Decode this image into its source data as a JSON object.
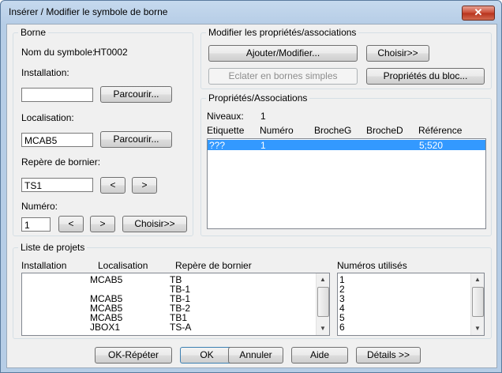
{
  "window": {
    "title": "Insérer / Modifier le symbole de borne",
    "close_label": "✕"
  },
  "borne": {
    "group_label": "Borne",
    "symbol_name_label": "Nom du symbole:",
    "symbol_name_value": "HT0002",
    "installation_label": "Installation:",
    "installation_value": "",
    "localisation_label": "Localisation:",
    "localisation_value": "MCAB5",
    "repere_label": "Repère de bornier:",
    "repere_value": "TS1",
    "numero_label": "Numéro:",
    "numero_value": "1",
    "browse_label": "Parcourir...",
    "prev_label": "<",
    "next_label": ">",
    "choose_label": "Choisir>>"
  },
  "modify": {
    "group_label": "Modifier les propriétés/associations",
    "add_modify_label": "Ajouter/Modifier...",
    "choose_label": "Choisir>>",
    "explode_label": "Eclater en bornes simples",
    "block_props_label": "Propriétés du bloc..."
  },
  "props": {
    "group_label": "Propriétés/Associations",
    "levels_label": "Niveaux:",
    "levels_value": "1",
    "columns": [
      "Etiquette",
      "Numéro",
      "BrocheG",
      "BrocheD",
      "Référence"
    ],
    "rows": [
      [
        "???",
        "1",
        "",
        "",
        "5;520"
      ]
    ]
  },
  "projects": {
    "group_label": "Liste de projets",
    "columns": [
      "Installation",
      "Localisation",
      "Repère de bornier"
    ],
    "rows": [
      [
        "",
        "MCAB5",
        "TB"
      ],
      [
        "",
        "",
        "TB-1"
      ],
      [
        "",
        "MCAB5",
        "TB-1"
      ],
      [
        "",
        "MCAB5",
        "TB-2"
      ],
      [
        "",
        "MCAB5",
        "TB1"
      ],
      [
        "",
        "JBOX1",
        "TS-A"
      ]
    ],
    "used_numbers_label": "Numéros utilisés",
    "used_numbers": [
      "1",
      "2",
      "3",
      "4",
      "5",
      "6"
    ]
  },
  "footer": {
    "ok_repeat_label": "OK-Répéter",
    "ok_label": "OK",
    "cancel_label": "Annuler",
    "help_label": "Aide",
    "details_label": "Détails >>"
  }
}
